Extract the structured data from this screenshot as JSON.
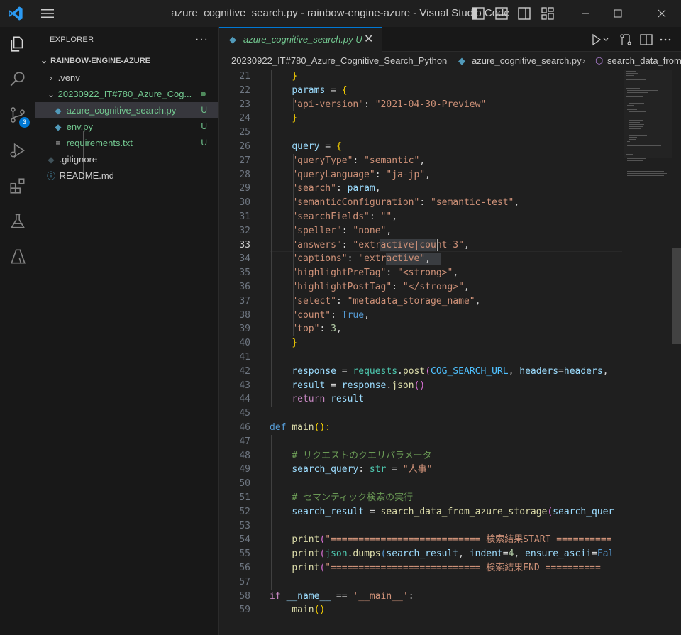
{
  "window": {
    "title": "azure_cognitive_search.py - rainbow-engine-azure - Visual Studio Code"
  },
  "sidebar": {
    "header": "EXPLORER",
    "root": "RAINBOW-ENGINE-AZURE",
    "items": [
      {
        "label": ".venv",
        "status": ""
      },
      {
        "label": "20230922_IT#780_Azure_Cog...",
        "status": ""
      },
      {
        "label": "azure_cognitive_search.py",
        "status": "U"
      },
      {
        "label": "env.py",
        "status": "U"
      },
      {
        "label": "requirements.txt",
        "status": "U"
      },
      {
        "label": ".gitignore",
        "status": ""
      },
      {
        "label": "README.md",
        "status": ""
      }
    ],
    "scm_badge": "3"
  },
  "tab": {
    "label": "azure_cognitive_search.py",
    "status": "U"
  },
  "breadcrumbs": [
    "20230922_IT#780_Azure_Cognitive_Search_Python",
    "azure_cognitive_search.py",
    "search_data_from"
  ],
  "editor": {
    "active_line": 33,
    "lines": [
      {
        "n": 21,
        "t": [
          [
            "        ",
            ""
          ],
          [
            "}",
            "y"
          ]
        ]
      },
      {
        "n": 22,
        "t": [
          [
            "        ",
            ""
          ],
          [
            "params",
            "v"
          ],
          [
            " = ",
            "o"
          ],
          [
            "{",
            "y"
          ]
        ]
      },
      {
        "n": 23,
        "t": [
          [
            "            ",
            ""
          ],
          [
            "\"api-version\"",
            "s"
          ],
          [
            ": ",
            "o"
          ],
          [
            "\"2021-04-30-Preview\"",
            "s"
          ]
        ]
      },
      {
        "n": 24,
        "t": [
          [
            "        ",
            ""
          ],
          [
            "}",
            "y"
          ]
        ]
      },
      {
        "n": 25,
        "t": []
      },
      {
        "n": 26,
        "t": [
          [
            "        ",
            ""
          ],
          [
            "query",
            "v"
          ],
          [
            " = ",
            "o"
          ],
          [
            "{",
            "y"
          ]
        ]
      },
      {
        "n": 27,
        "t": [
          [
            "            ",
            ""
          ],
          [
            "\"queryType\"",
            "s"
          ],
          [
            ": ",
            "o"
          ],
          [
            "\"semantic\"",
            "s"
          ],
          [
            ",",
            "o"
          ]
        ]
      },
      {
        "n": 28,
        "t": [
          [
            "            ",
            ""
          ],
          [
            "\"queryLanguage\"",
            "s"
          ],
          [
            ": ",
            "o"
          ],
          [
            "\"ja-jp\"",
            "s"
          ],
          [
            ",",
            "o"
          ]
        ]
      },
      {
        "n": 29,
        "t": [
          [
            "            ",
            ""
          ],
          [
            "\"search\"",
            "s"
          ],
          [
            ": ",
            "o"
          ],
          [
            "param",
            "v"
          ],
          [
            ",",
            "o"
          ]
        ]
      },
      {
        "n": 30,
        "t": [
          [
            "            ",
            ""
          ],
          [
            "\"semanticConfiguration\"",
            "s"
          ],
          [
            ": ",
            "o"
          ],
          [
            "\"semantic-test\"",
            "s"
          ],
          [
            ",",
            "o"
          ]
        ]
      },
      {
        "n": 31,
        "t": [
          [
            "            ",
            ""
          ],
          [
            "\"searchFields\"",
            "s"
          ],
          [
            ": ",
            "o"
          ],
          [
            "\"\"",
            "s"
          ],
          [
            ",",
            "o"
          ]
        ]
      },
      {
        "n": 32,
        "t": [
          [
            "            ",
            ""
          ],
          [
            "\"speller\"",
            "s"
          ],
          [
            ": ",
            "o"
          ],
          [
            "\"none\"",
            "s"
          ],
          [
            ",",
            "o"
          ]
        ]
      },
      {
        "n": 33,
        "t": [
          [
            "            ",
            ""
          ],
          [
            "\"answers\"",
            "s"
          ],
          [
            ": ",
            "o"
          ],
          [
            "\"extractive|count-3\"",
            "s"
          ],
          [
            ",",
            "o"
          ]
        ]
      },
      {
        "n": 34,
        "t": [
          [
            "            ",
            ""
          ],
          [
            "\"captions\"",
            "s"
          ],
          [
            ": ",
            "o"
          ],
          [
            "\"extractive\"",
            "s"
          ],
          [
            ",",
            "o"
          ]
        ]
      },
      {
        "n": 35,
        "t": [
          [
            "            ",
            ""
          ],
          [
            "\"highlightPreTag\"",
            "s"
          ],
          [
            ": ",
            "o"
          ],
          [
            "\"<strong>\"",
            "s"
          ],
          [
            ",",
            "o"
          ]
        ]
      },
      {
        "n": 36,
        "t": [
          [
            "            ",
            ""
          ],
          [
            "\"highlightPostTag\"",
            "s"
          ],
          [
            ": ",
            "o"
          ],
          [
            "\"</strong>\"",
            "s"
          ],
          [
            ",",
            "o"
          ]
        ]
      },
      {
        "n": 37,
        "t": [
          [
            "            ",
            ""
          ],
          [
            "\"select\"",
            "s"
          ],
          [
            ": ",
            "o"
          ],
          [
            "\"metadata_storage_name\"",
            "s"
          ],
          [
            ",",
            "o"
          ]
        ]
      },
      {
        "n": 38,
        "t": [
          [
            "            ",
            ""
          ],
          [
            "\"count\"",
            "s"
          ],
          [
            ": ",
            "o"
          ],
          [
            "True",
            "b"
          ],
          [
            ",",
            "o"
          ]
        ]
      },
      {
        "n": 39,
        "t": [
          [
            "            ",
            ""
          ],
          [
            "\"top\"",
            "s"
          ],
          [
            ": ",
            "o"
          ],
          [
            "3",
            "n"
          ],
          [
            ",",
            "o"
          ]
        ]
      },
      {
        "n": 40,
        "t": [
          [
            "        ",
            ""
          ],
          [
            "}",
            "y"
          ]
        ]
      },
      {
        "n": 41,
        "t": []
      },
      {
        "n": 42,
        "t": [
          [
            "        ",
            ""
          ],
          [
            "response",
            "v"
          ],
          [
            " = ",
            "o"
          ],
          [
            "requests",
            "t"
          ],
          [
            ".",
            "o"
          ],
          [
            "post",
            "f"
          ],
          [
            "(",
            "p"
          ],
          [
            "COG_SEARCH_URL",
            "u"
          ],
          [
            ", ",
            "o"
          ],
          [
            "headers",
            "v"
          ],
          [
            "=",
            "o"
          ],
          [
            "headers",
            "v"
          ],
          [
            ",",
            "o"
          ]
        ]
      },
      {
        "n": 43,
        "t": [
          [
            "        ",
            ""
          ],
          [
            "result",
            "v"
          ],
          [
            " = ",
            "o"
          ],
          [
            "response",
            "v"
          ],
          [
            ".",
            "o"
          ],
          [
            "json",
            "f"
          ],
          [
            "()",
            "p"
          ]
        ]
      },
      {
        "n": 44,
        "t": [
          [
            "        ",
            ""
          ],
          [
            "return",
            "k"
          ],
          [
            " ",
            "o"
          ],
          [
            "result",
            "v"
          ]
        ]
      },
      {
        "n": 45,
        "t": []
      },
      {
        "n": 46,
        "t": [
          [
            "def",
            "b"
          ],
          [
            " ",
            "o"
          ],
          [
            "main",
            "f"
          ],
          [
            "():",
            "y"
          ]
        ]
      },
      {
        "n": 47,
        "t": []
      },
      {
        "n": 48,
        "t": [
          [
            "        ",
            ""
          ],
          [
            "# リクエストのクエリパラメータ",
            "c"
          ]
        ]
      },
      {
        "n": 49,
        "t": [
          [
            "        ",
            ""
          ],
          [
            "search_query",
            "v"
          ],
          [
            ": ",
            "o"
          ],
          [
            "str",
            "t"
          ],
          [
            " = ",
            "o"
          ],
          [
            "\"人事\"",
            "s"
          ]
        ]
      },
      {
        "n": 50,
        "t": []
      },
      {
        "n": 51,
        "t": [
          [
            "        ",
            ""
          ],
          [
            "# セマンティック検索の実行",
            "c"
          ]
        ]
      },
      {
        "n": 52,
        "t": [
          [
            "        ",
            ""
          ],
          [
            "search_result",
            "v"
          ],
          [
            " = ",
            "o"
          ],
          [
            "search_data_from_azure_storage",
            "f"
          ],
          [
            "(",
            "p"
          ],
          [
            "search_quer",
            "v"
          ]
        ]
      },
      {
        "n": 53,
        "t": []
      },
      {
        "n": 54,
        "t": [
          [
            "        ",
            ""
          ],
          [
            "print",
            "f"
          ],
          [
            "(",
            "p"
          ],
          [
            "\"=========================== 検索結果START ==========",
            "s"
          ]
        ]
      },
      {
        "n": 55,
        "t": [
          [
            "        ",
            ""
          ],
          [
            "print",
            "f"
          ],
          [
            "(",
            "p"
          ],
          [
            "json",
            "t"
          ],
          [
            ".",
            "o"
          ],
          [
            "dumps",
            "f"
          ],
          [
            "(",
            "b"
          ],
          [
            "search_result",
            "v"
          ],
          [
            ", ",
            "o"
          ],
          [
            "indent",
            "v"
          ],
          [
            "=",
            "o"
          ],
          [
            "4",
            "n"
          ],
          [
            ", ",
            "o"
          ],
          [
            "ensure_ascii",
            "v"
          ],
          [
            "=",
            "o"
          ],
          [
            "Fal",
            "b"
          ]
        ]
      },
      {
        "n": 56,
        "t": [
          [
            "        ",
            ""
          ],
          [
            "print",
            "f"
          ],
          [
            "(",
            "p"
          ],
          [
            "\"=========================== 検索結果END ==========",
            "s"
          ]
        ]
      },
      {
        "n": 57,
        "t": []
      },
      {
        "n": 58,
        "t": [
          [
            "if",
            "k"
          ],
          [
            " ",
            "o"
          ],
          [
            "__name__",
            "v"
          ],
          [
            " == ",
            "o"
          ],
          [
            "'__main__'",
            "s"
          ],
          [
            ":",
            "o"
          ]
        ]
      },
      {
        "n": 59,
        "t": [
          [
            "        ",
            ""
          ],
          [
            "main",
            "f"
          ],
          [
            "()",
            "y"
          ]
        ]
      }
    ]
  },
  "colors": {
    "accent": "#0078d4",
    "untracked": "#73c991",
    "python_icon": "#519aba"
  }
}
